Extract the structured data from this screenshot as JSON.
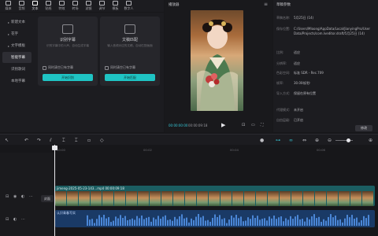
{
  "toolbar": {
    "items": [
      {
        "label": "媒体",
        "icon": "media-icon"
      },
      {
        "label": "音频",
        "icon": "audio-icon"
      },
      {
        "label": "文本",
        "icon": "text-icon"
      },
      {
        "label": "贴纸",
        "icon": "sticker-icon"
      },
      {
        "label": "特效",
        "icon": "effects-icon"
      },
      {
        "label": "转场",
        "icon": "transition-icon"
      },
      {
        "label": "滤镜",
        "icon": "filter-icon"
      },
      {
        "label": "调节",
        "icon": "adjust-icon"
      },
      {
        "label": "模板",
        "icon": "template-icon"
      },
      {
        "label": "数字人",
        "icon": "avatar-icon"
      }
    ],
    "active_index": 2
  },
  "categories": [
    {
      "label": "新建文本",
      "arrow": true
    },
    {
      "label": "花字",
      "arrow": true
    },
    {
      "label": "文字模板",
      "arrow": true
    },
    {
      "label": "智能字幕",
      "arrow": false,
      "active": true
    },
    {
      "label": "识别歌词",
      "arrow": false
    },
    {
      "label": "本地字幕",
      "arrow": false
    }
  ],
  "cards": [
    {
      "title": "识别字幕",
      "desc": "识别字幕中的人声，自动生成字幕",
      "checkbox": "同时清空已有字幕",
      "button": "开始识别"
    },
    {
      "title": "文稿匹配",
      "desc": "输入音频对应的文稿，自动匹配画面",
      "checkbox": "同时清空已有字幕",
      "button": "开始匹配"
    }
  ],
  "player": {
    "title": "播放器",
    "current_time": "00:00:00:00",
    "total_time": "00:00:09:18"
  },
  "properties": {
    "title": "草稿参数",
    "rows": [
      {
        "k": "草稿名称:",
        "v": "5月25日 (14)"
      },
      {
        "k": "保存位置:",
        "v": "C:/Users/Mloong/AppData/Local/JianyingPro/User Data/Projects/com.lveditor.draft/5月25日 (14)"
      },
      {
        "k": "比例:",
        "v": "适应"
      },
      {
        "k": "分辨率:",
        "v": "适应"
      },
      {
        "k": "色彩空间:",
        "v": "标准 SDR - Rec.709"
      },
      {
        "k": "帧率:",
        "v": "30.00帧/秒"
      },
      {
        "k": "导入方式:",
        "v": "保留在原有位置"
      },
      {
        "k": "代理模式:",
        "v": "未开启"
      },
      {
        "k": "自由层级:",
        "v": "已开启"
      }
    ],
    "export_button": "修改"
  },
  "timeline": {
    "ruler_ticks": [
      "00:00",
      "00:02",
      "00:04",
      "00:06"
    ],
    "video_clip_label": "jimeng-2025-05-23-143...mp4  00:00:09:18",
    "audio_clip_label": "认识青春写实",
    "cover_label": "封面"
  }
}
